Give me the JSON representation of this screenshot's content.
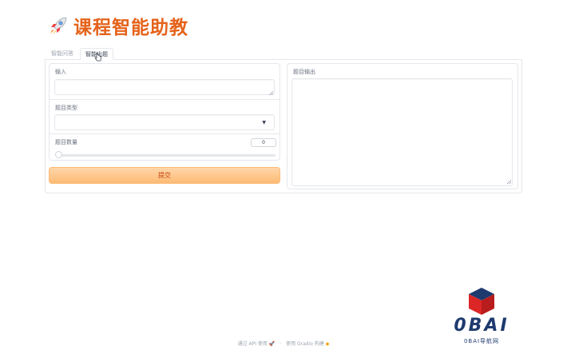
{
  "app": {
    "title": "课程智能助教",
    "title_icon": "rocket-icon",
    "accent_color": "#e5631b"
  },
  "tabs": [
    {
      "label": "智能问答",
      "selected": false
    },
    {
      "label": "智能出题",
      "selected": true
    }
  ],
  "form": {
    "input_label": "输入",
    "input_value": "",
    "type_label": "题目类型",
    "type_value": "",
    "count_label": "题目数量",
    "count_value": "0",
    "slider_value": 0,
    "submit_label": "提交"
  },
  "output": {
    "label": "题目输出",
    "value": ""
  },
  "footer": {
    "api_text": "通过 API 使用",
    "built_text": "使用 Gradio 构建"
  },
  "watermark": {
    "brand": "0BAI",
    "subtitle": "0BAI导航网"
  }
}
